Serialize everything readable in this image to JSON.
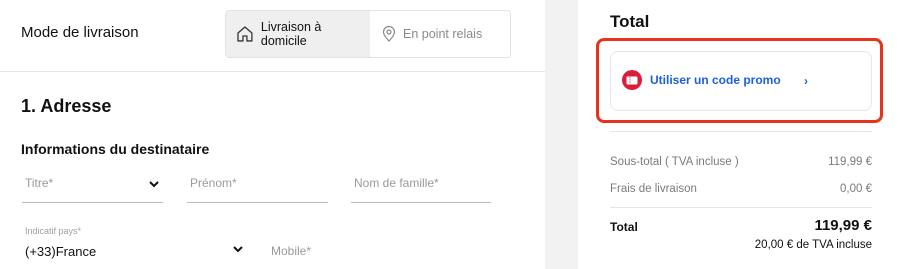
{
  "delivery": {
    "title": "Mode de livraison",
    "options": [
      {
        "label": "Livraison à domicile",
        "icon": "home-icon",
        "selected": true
      },
      {
        "label": "En point relais",
        "icon": "location-pin-icon",
        "selected": false
      }
    ]
  },
  "address": {
    "title": "1. Adresse",
    "recipient_title": "Informations du destinataire",
    "fields": {
      "title_placeholder": "Titre*",
      "first_name_placeholder": "Prénom*",
      "last_name_placeholder": "Nom de famille*"
    },
    "country_code": {
      "label": "Indicatif pays*",
      "value": "(+33)France"
    },
    "mobile_placeholder": "Mobile*"
  },
  "summary": {
    "heading": "Total",
    "promo_label": "Utiliser un code promo",
    "promo_chevron": "›",
    "subtotal_label": "Sous-total ( TVA incluse )",
    "subtotal_value": "119,99 €",
    "shipping_label": "Frais de livraison",
    "shipping_value": "0,00 €",
    "total_label": "Total",
    "total_value": "119,99 €",
    "vat_note": "20,00 € de TVA incluse"
  },
  "colors": {
    "highlight": "#e8321a",
    "link": "#1c5fd9",
    "promo_icon": "#d81e3c"
  }
}
